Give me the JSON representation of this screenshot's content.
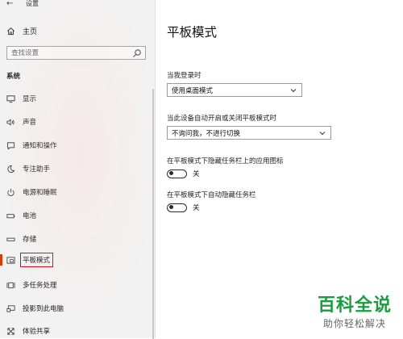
{
  "window": {
    "title": "设置",
    "back_icon": "back-arrow-icon"
  },
  "sidebar": {
    "home_label": "主页",
    "search_placeholder": "查找设置",
    "section_label": "系统",
    "items": [
      {
        "label": "显示",
        "icon": "monitor-icon"
      },
      {
        "label": "声音",
        "icon": "speaker-icon"
      },
      {
        "label": "通知和操作",
        "icon": "notification-icon"
      },
      {
        "label": "专注助手",
        "icon": "moon-icon"
      },
      {
        "label": "电源和睡眠",
        "icon": "power-icon"
      },
      {
        "label": "电池",
        "icon": "battery-icon"
      },
      {
        "label": "存储",
        "icon": "storage-icon"
      },
      {
        "label": "平板模式",
        "icon": "tablet-icon",
        "selected": true
      },
      {
        "label": "多任务处理",
        "icon": "multitask-icon"
      },
      {
        "label": "投影到此电脑",
        "icon": "project-icon"
      },
      {
        "label": "体验共享",
        "icon": "share-icon"
      }
    ]
  },
  "main": {
    "title": "平板模式",
    "signin_label": "当我登录时",
    "signin_value": "使用桌面模式",
    "autoswitch_label": "当此设备自动开启或关闭平板模式时",
    "autoswitch_value": "不询问我，不进行切换",
    "hide_icons_label": "在平板模式下隐藏任务栏上的应用图标",
    "hide_icons_state": "关",
    "hide_taskbar_label": "在平板模式下自动隐藏任务栏",
    "hide_taskbar_state": "关"
  },
  "watermark": {
    "line1": "百科全说",
    "line2": "助你轻松解决"
  },
  "colors": {
    "accent": "#d83b01",
    "highlight_box": "#e60012",
    "watermark_green": "#1a9d3c"
  }
}
